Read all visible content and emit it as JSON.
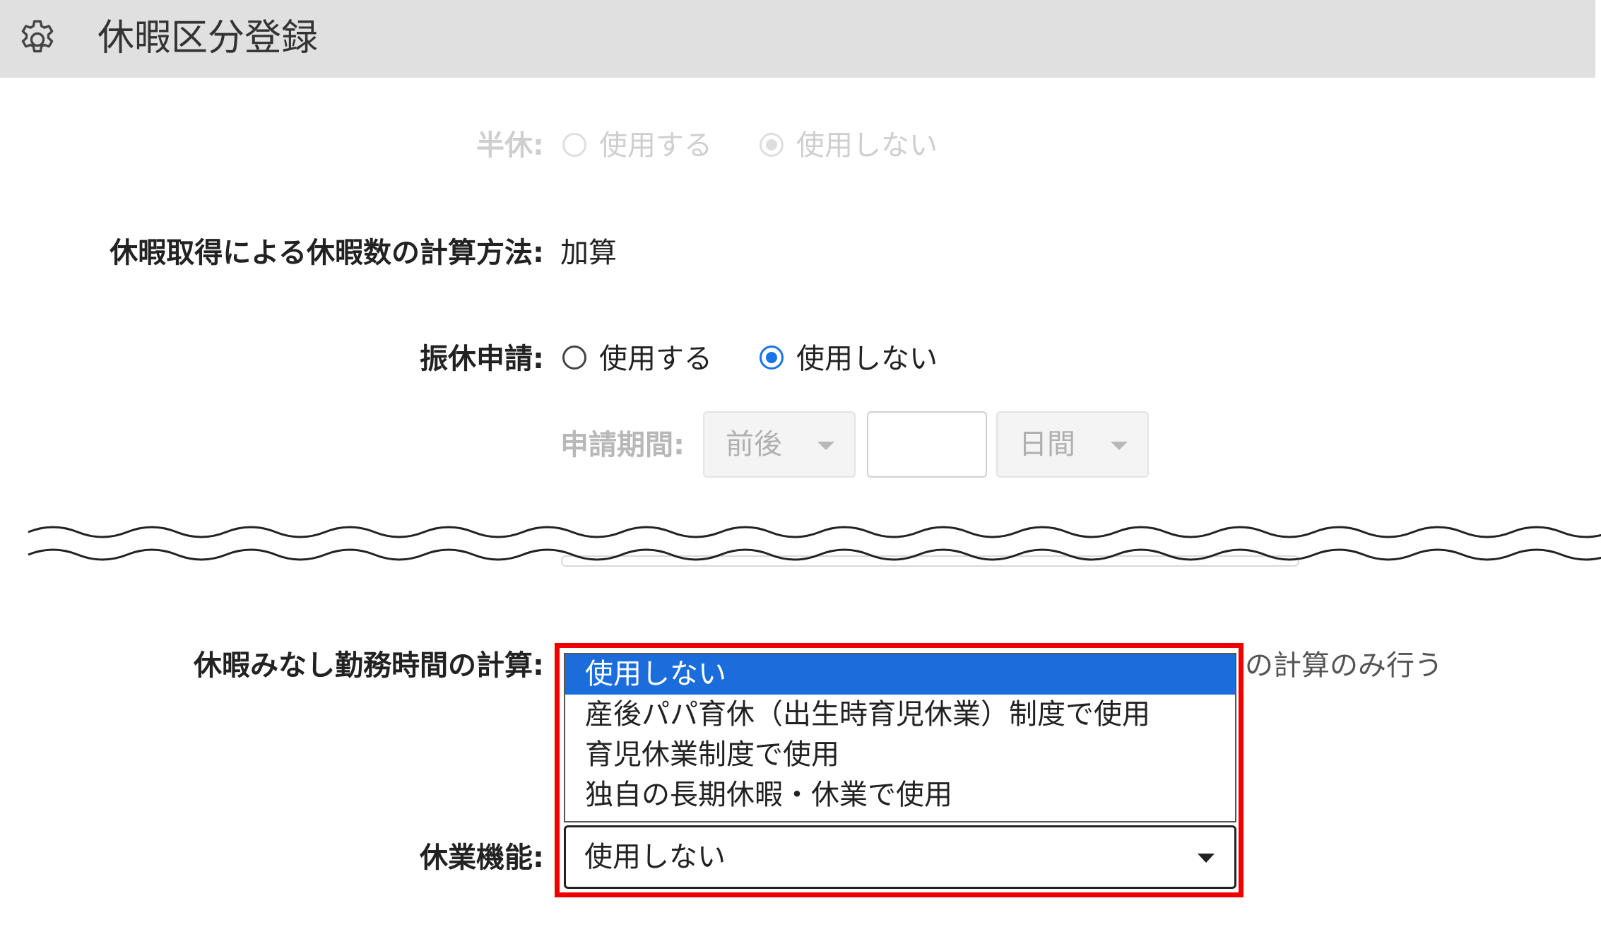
{
  "header": {
    "title": "休暇区分登録",
    "icon": "gear-icon"
  },
  "half_day": {
    "label": "半休:",
    "options": [
      "使用する",
      "使用しない"
    ],
    "selected": "使用しない"
  },
  "calc_method": {
    "label": "休暇取得による休暇数の計算方法:",
    "value": "加算"
  },
  "substitute": {
    "label": "振休申請:",
    "options": [
      "使用する",
      "使用しない"
    ],
    "selected": "使用しない",
    "period_label": "申請期間:",
    "period_direction": "前後",
    "period_value": "",
    "period_unit": "日間"
  },
  "deemed_hours": {
    "label": "休暇みなし勤務時間の計算:",
    "visible_option_tail": "の計算のみ行う"
  },
  "leave_function": {
    "label": "休業機能:",
    "selected": "使用しない",
    "options": [
      "使用しない",
      "産後パパ育休（出生時育児休業）制度で使用",
      "育児休業制度で使用",
      "独自の長期休暇・休業で使用"
    ]
  },
  "colors": {
    "highlight_border": "#ee0000",
    "selected_option": "#1a6ddb",
    "radio_checked": "#1a73e8",
    "header_bg": "#e0e0e0"
  }
}
